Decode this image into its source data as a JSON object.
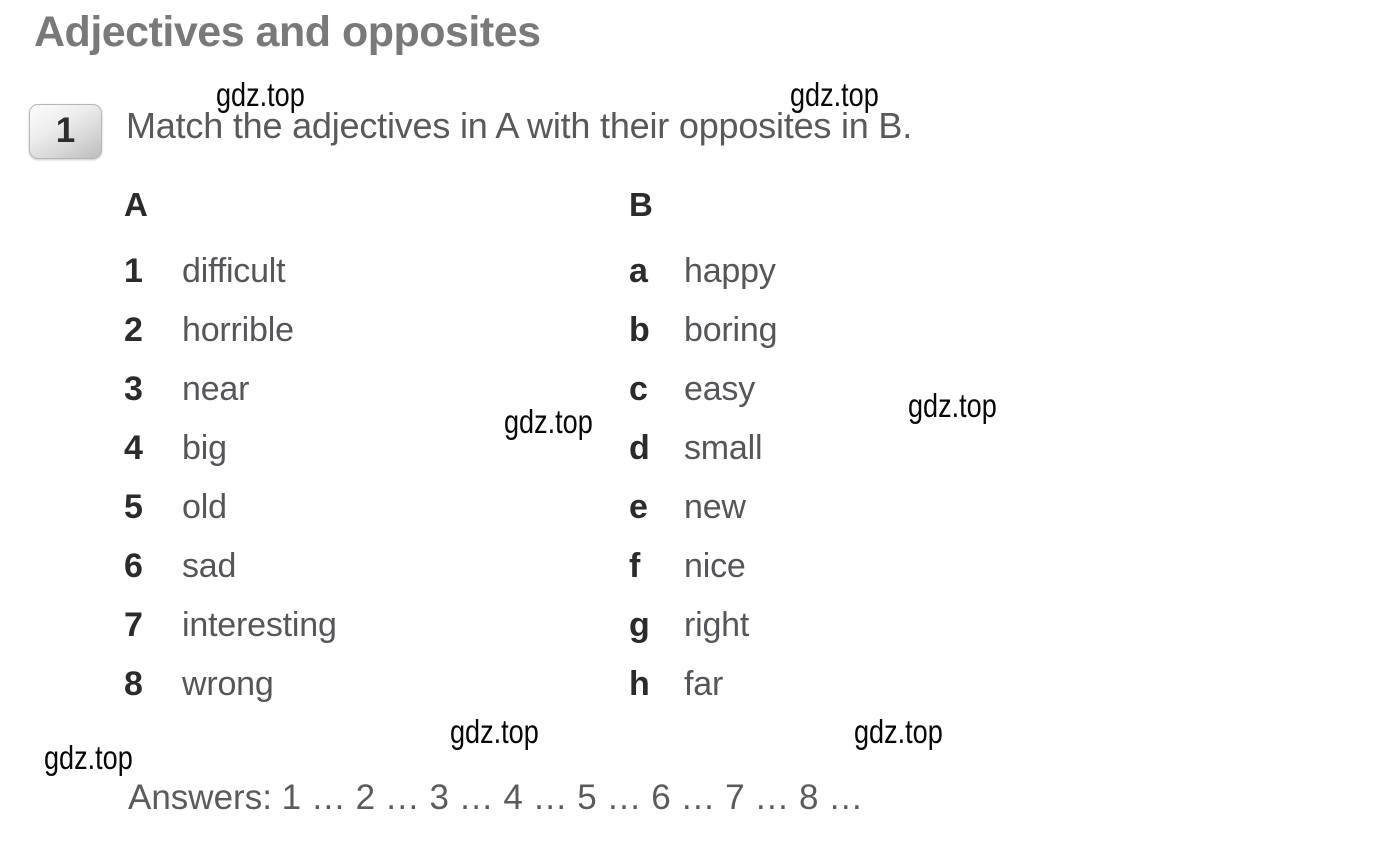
{
  "page": {
    "title": "Adjectives and opposites",
    "background_color": "#ffffff",
    "title_color": "#78797b",
    "body_text_color": "#56565a"
  },
  "exercise": {
    "number": "1",
    "instruction": "Match the adjectives in A with their opposites in B."
  },
  "columns": {
    "a": {
      "header": "A",
      "items": [
        {
          "key": "1",
          "word": "difficult"
        },
        {
          "key": "2",
          "word": "horrible"
        },
        {
          "key": "3",
          "word": "near"
        },
        {
          "key": "4",
          "word": "big"
        },
        {
          "key": "5",
          "word": "old"
        },
        {
          "key": "6",
          "word": "sad"
        },
        {
          "key": "7",
          "word": "interesting"
        },
        {
          "key": "8",
          "word": "wrong"
        }
      ]
    },
    "b": {
      "header": "B",
      "items": [
        {
          "key": "a",
          "word": "happy"
        },
        {
          "key": "b",
          "word": "boring"
        },
        {
          "key": "c",
          "word": "easy"
        },
        {
          "key": "d",
          "word": "small"
        },
        {
          "key": "e",
          "word": "new"
        },
        {
          "key": "f",
          "word": "nice"
        },
        {
          "key": "g",
          "word": "right"
        },
        {
          "key": "h",
          "word": "far"
        }
      ]
    }
  },
  "answers": {
    "line": "Answers: 1 … 2 … 3 … 4 … 5 … 6 … 7 … 8 …"
  },
  "watermarks": {
    "text": "gdz.top",
    "count": 7
  }
}
